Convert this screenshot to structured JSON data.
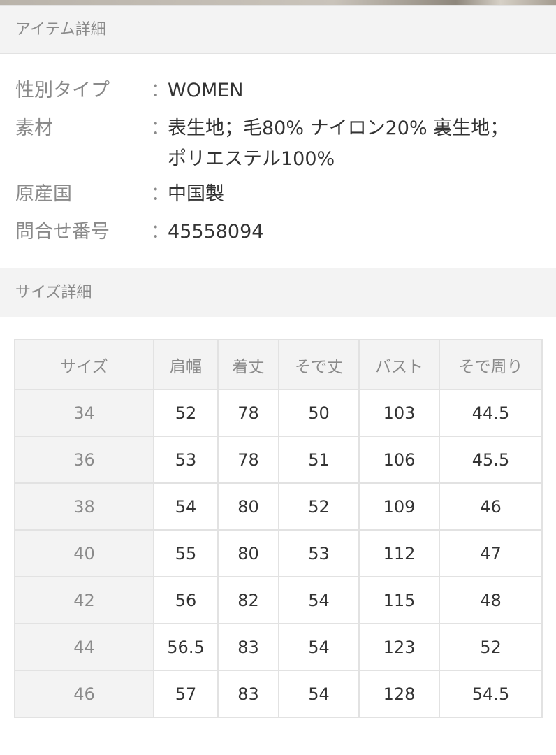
{
  "item_details": {
    "header": "アイテム詳細",
    "rows": [
      {
        "label": "性別タイプ",
        "colon": "：",
        "value": "WOMEN"
      },
      {
        "label": "素材",
        "colon": "：",
        "value": "表生地；毛80% ナイロン20% 裏生地；\nポリエステル100%"
      },
      {
        "label": "原産国",
        "colon": "：",
        "value": "中国製"
      },
      {
        "label": "問合せ番号",
        "colon": "：",
        "value": "45558094"
      }
    ]
  },
  "size_details": {
    "header": "サイズ詳細",
    "columns": [
      "サイズ",
      "肩幅",
      "着丈",
      "そで丈",
      "バスト",
      "そで周り"
    ],
    "rows": [
      [
        "34",
        "52",
        "78",
        "50",
        "103",
        "44.5"
      ],
      [
        "36",
        "53",
        "78",
        "51",
        "106",
        "45.5"
      ],
      [
        "38",
        "54",
        "80",
        "52",
        "109",
        "46"
      ],
      [
        "40",
        "55",
        "80",
        "53",
        "112",
        "47"
      ],
      [
        "42",
        "56",
        "82",
        "54",
        "115",
        "48"
      ],
      [
        "44",
        "56.5",
        "83",
        "54",
        "123",
        "52"
      ],
      [
        "46",
        "57",
        "83",
        "54",
        "128",
        "54.5"
      ]
    ]
  }
}
